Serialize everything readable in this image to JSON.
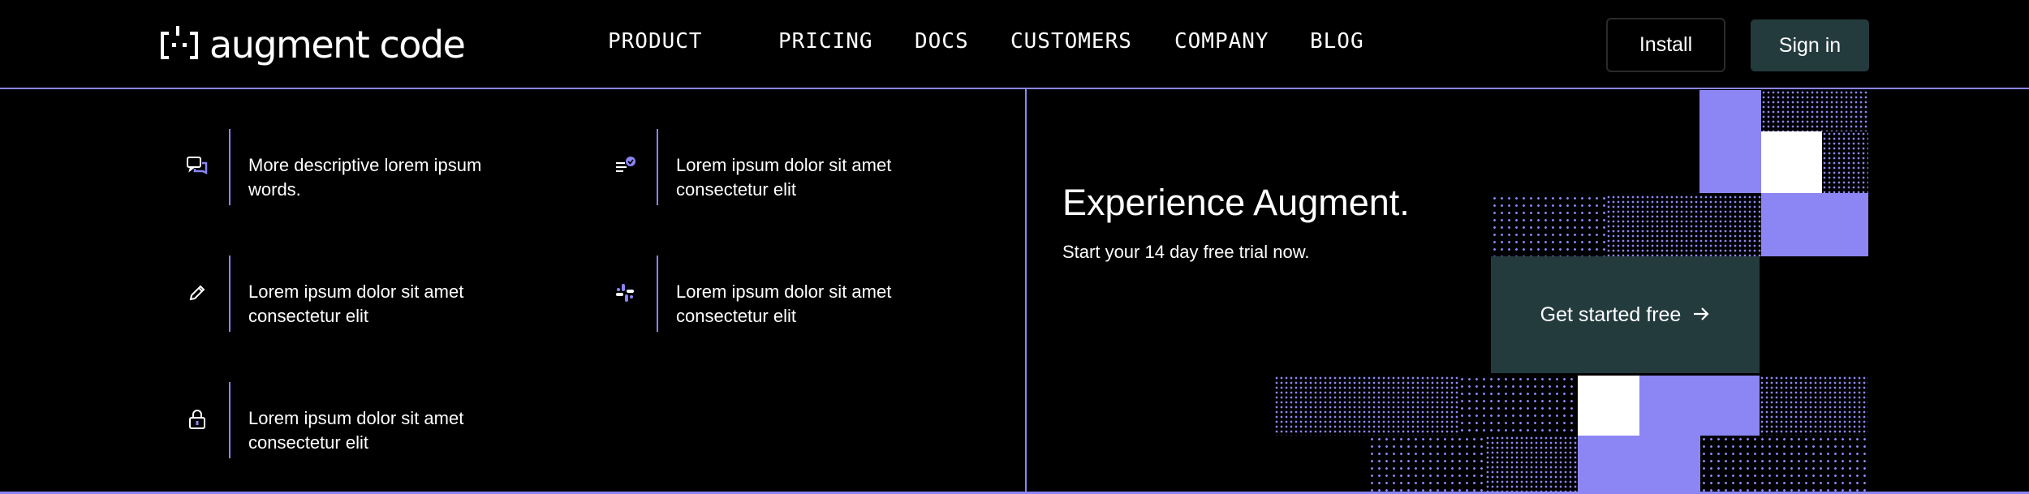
{
  "brand": {
    "name": "augment code"
  },
  "nav": {
    "items": [
      {
        "label": "PRODUCT"
      },
      {
        "label": "PRICING"
      },
      {
        "label": "DOCS"
      },
      {
        "label": "CUSTOMERS"
      },
      {
        "label": "COMPANY"
      },
      {
        "label": "BLOG"
      }
    ]
  },
  "header": {
    "install_label": "Install",
    "signin_label": "Sign in"
  },
  "features": [
    {
      "icon": "chat-bubbles-icon",
      "text": "More descriptive lorem ipsum words."
    },
    {
      "icon": "checklist-icon",
      "text": "Lorem ipsum dolor sit amet consectetur elit"
    },
    {
      "icon": "pencil-icon",
      "text": "Lorem ipsum dolor sit amet consectetur elit"
    },
    {
      "icon": "slack-icon",
      "text": "Lorem ipsum dolor sit amet consectetur elit"
    },
    {
      "icon": "lock-icon",
      "text": "Lorem ipsum dolor sit amet consectetur elit"
    }
  ],
  "cta": {
    "title": "Experience Augment.",
    "subtitle": "Start your 14 day free trial now.",
    "button_label": "Get started free",
    "button_icon": "arrow-right-icon"
  },
  "colors": {
    "accent": "#8b86f4",
    "button_dark": "#243b3e",
    "background": "#000000"
  }
}
